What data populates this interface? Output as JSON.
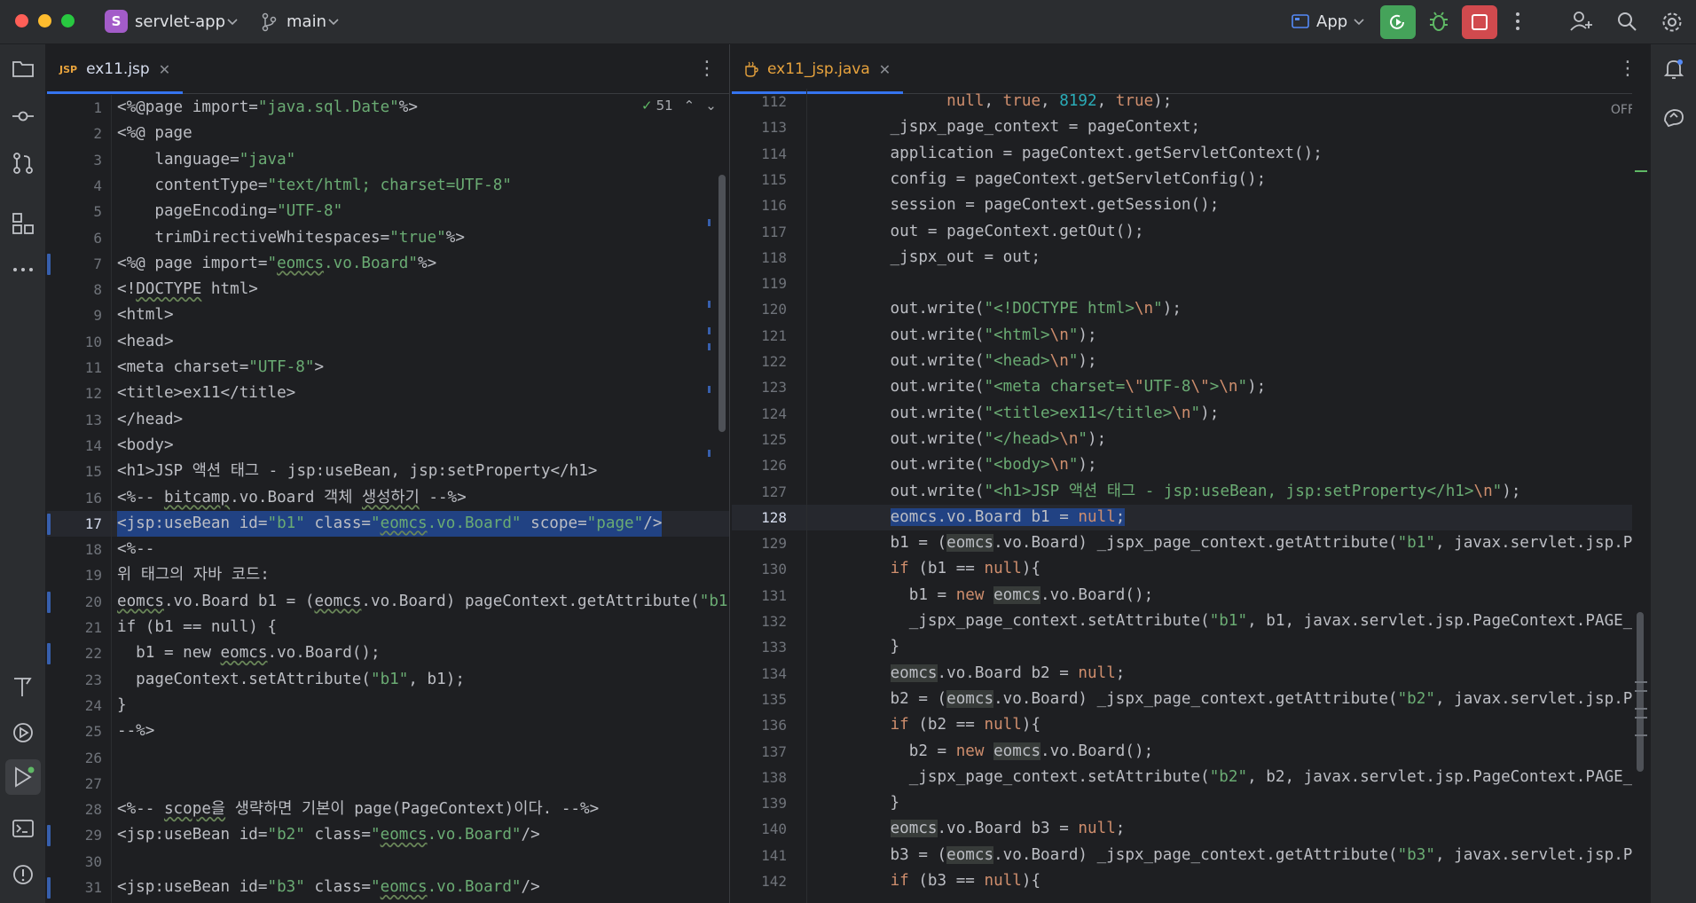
{
  "titlebar": {
    "project_badge": "S",
    "project_name": "servlet-app",
    "branch": "main",
    "run_config": "App"
  },
  "left_editor": {
    "tab_icon_text": "JSP",
    "tab_label": "ex11.jsp",
    "inspection_count": "51",
    "current_line": 17
  },
  "right_editor": {
    "tab_label": "ex11_jsp.java",
    "reader_mode": "OFF",
    "current_line": 128
  },
  "colors": {
    "accent": "#3574f0",
    "run_green": "#45a35a",
    "stop_red": "#d14a4e",
    "string_green": "#6aab73",
    "keyword_orange": "#cf8e6d"
  },
  "icons": {
    "titlebar": [
      "branch-icon",
      "run-config-icon",
      "rerun-icon",
      "debug-icon",
      "stop-icon",
      "more-icon",
      "add-user-icon",
      "search-icon",
      "settings-icon"
    ],
    "left_strip": [
      "project-folder-icon",
      "commit-icon",
      "pull-requests-icon",
      "structure-icon",
      "more-tools-icon",
      "build-icon",
      "services-icon",
      "run-icon",
      "terminal-icon",
      "problems-icon"
    ],
    "right_strip": [
      "notifications-icon",
      "ai-assistant-icon"
    ]
  }
}
